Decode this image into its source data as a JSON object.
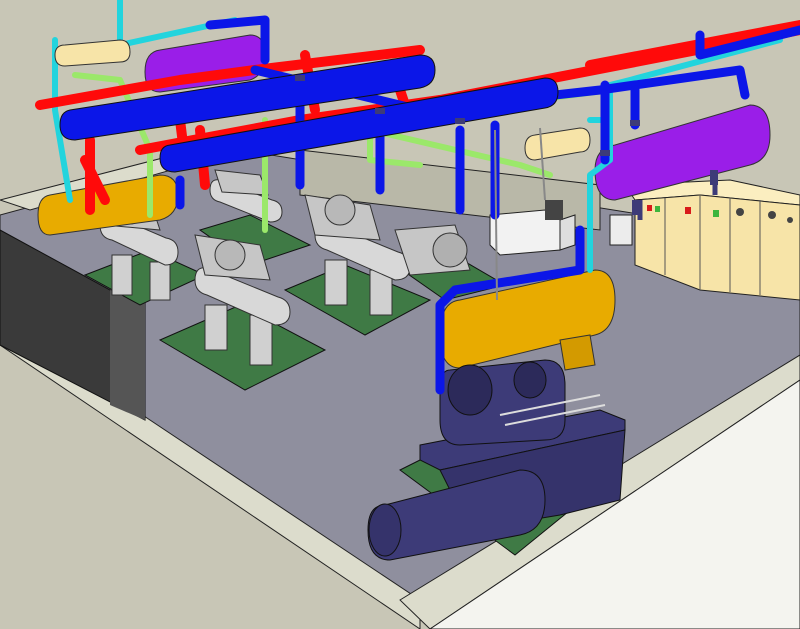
{
  "scene": {
    "kind": "3d-model-render",
    "colors": {
      "background": "#c8c6b6",
      "floor": "#8f8f9e",
      "wall_top": "#dcdccc",
      "wall_front": "#f4f4ef",
      "hot_pipe": "#ff0a0a",
      "cold_pipe": "#0b16e8",
      "cyan_pipe": "#22d4dd",
      "green_pipe": "#9be86a",
      "violet_vessel": "#9a1ee8",
      "yellow_vessel": "#e8ab00",
      "machine_gray": "#d8d8d8",
      "compressor_navy": "#3d3b78",
      "skid_green": "#3f7a45",
      "panel_cream": "#f7e4a8",
      "panel_red": "#d81a1a",
      "panel_green": "#3db53d",
      "black_wall": "#3a3a3a"
    },
    "objects": [
      "floor",
      "back-wall",
      "front-wall",
      "left-black-wall",
      "compressor-units",
      "horizontal-receivers",
      "surge-drums",
      "control-panels",
      "main-compressor",
      "pipe-network"
    ]
  }
}
